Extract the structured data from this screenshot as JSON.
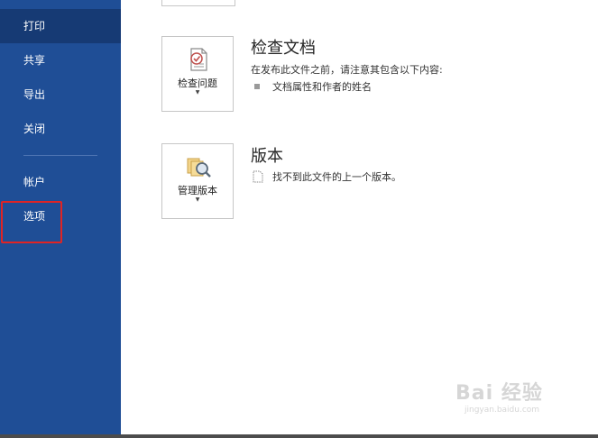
{
  "sidebar": {
    "items": [
      {
        "label": "打印"
      },
      {
        "label": "共享"
      },
      {
        "label": "导出"
      },
      {
        "label": "关闭"
      },
      {
        "label": "帐户"
      },
      {
        "label": "选项"
      }
    ]
  },
  "inspect": {
    "button_label": "检查问题",
    "title": "检查文档",
    "description": "在发布此文件之前，请注意其包含以下内容:",
    "bullet": "文档属性和作者的姓名"
  },
  "versions": {
    "button_label": "管理版本",
    "title": "版本",
    "description": "找不到此文件的上一个版本。"
  },
  "watermark": {
    "brand": "Bai 经验",
    "url": "jingyan.baidu.com"
  },
  "colors": {
    "sidebar": "#1f4e96",
    "sidebar_active": "#163a74",
    "highlight": "#e02424"
  }
}
